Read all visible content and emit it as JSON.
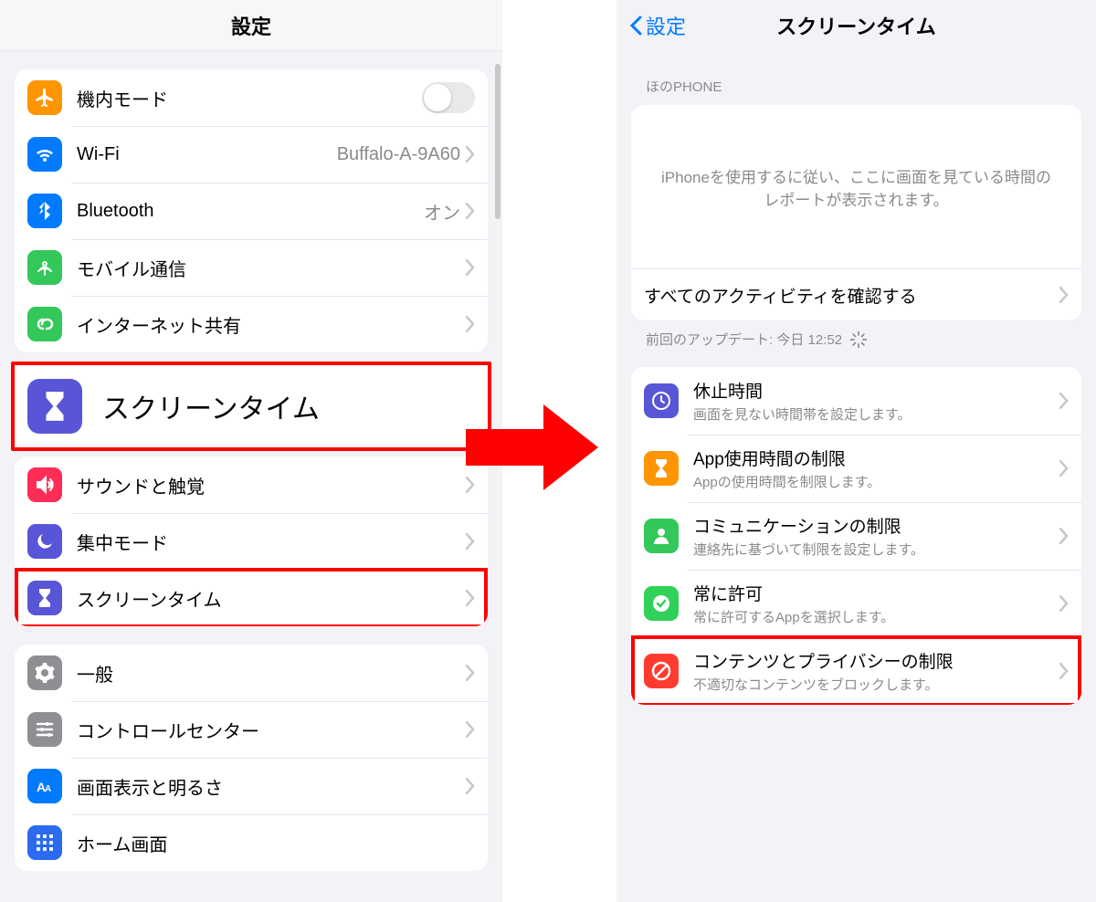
{
  "left": {
    "title": "設定",
    "rows": {
      "airplane": "機内モード",
      "wifi_label": "Wi-Fi",
      "wifi_value": "Buffalo-A-9A60",
      "bluetooth_label": "Bluetooth",
      "bluetooth_value": "オン",
      "cellular": "モバイル通信",
      "hotspot": "インターネット共有",
      "screentime_big": "スクリーンタイム",
      "sounds": "サウンドと触覚",
      "focus": "集中モード",
      "screentime_small": "スクリーンタイム",
      "general": "一般",
      "control": "コントロールセンター",
      "display": "画面表示と明るさ",
      "home": "ホーム画面"
    }
  },
  "right": {
    "back": "設定",
    "title": "スクリーンタイム",
    "device_header": "ほのPHONE",
    "report_text": "iPhoneを使用するに従い、ここに画面を見ている時間のレポートが表示されます。",
    "all_activity": "すべてのアクティビティを確認する",
    "last_update": "前回のアップデート: 今日 12:52",
    "items": {
      "downtime_title": "休止時間",
      "downtime_sub": "画面を見ない時間帯を設定します。",
      "applimit_title": "App使用時間の制限",
      "applimit_sub": "Appの使用時間を制限します。",
      "comm_title": "コミュニケーションの制限",
      "comm_sub": "連絡先に基づいて制限を設定します。",
      "allow_title": "常に許可",
      "allow_sub": "常に許可するAppを選択します。",
      "content_title": "コンテンツとプライバシーの制限",
      "content_sub": "不適切なコンテンツをブロックします。"
    }
  }
}
